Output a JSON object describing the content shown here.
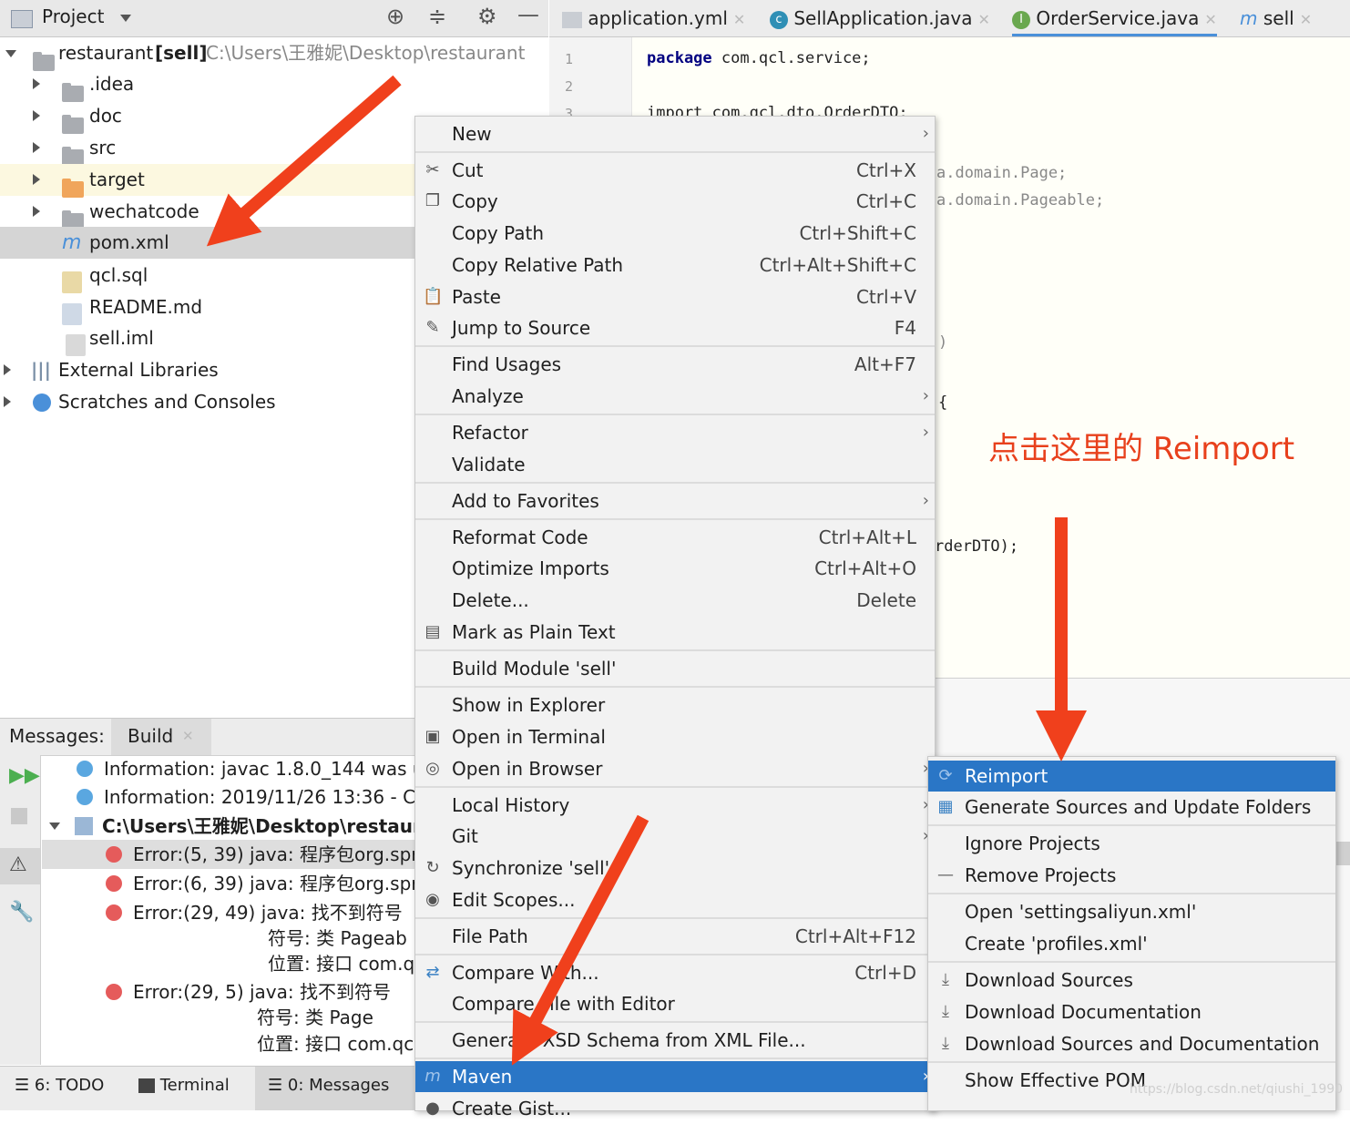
{
  "project_panel": {
    "title": "Project",
    "tree": [
      {
        "label": "restaurant",
        "module": "[sell]",
        "path": "C:\\Users\\王雅妮\\Desktop\\restaurant"
      },
      {
        "label": ".idea"
      },
      {
        "label": "doc"
      },
      {
        "label": "src"
      },
      {
        "label": "target"
      },
      {
        "label": "wechatcode"
      },
      {
        "label": "pom.xml"
      },
      {
        "label": "qcl.sql"
      },
      {
        "label": "README.md"
      },
      {
        "label": "sell.iml"
      },
      {
        "label": "External Libraries"
      },
      {
        "label": "Scratches and Consoles"
      }
    ]
  },
  "tabs": [
    {
      "label": "application.yml"
    },
    {
      "label": "SellApplication.java"
    },
    {
      "label": "OrderService.java"
    },
    {
      "label": "sell"
    }
  ],
  "editor": {
    "line_numbers": [
      "1",
      "2",
      "3"
    ],
    "lines": {
      "l1_kw": "package",
      "l1_rest": " com.qcl.service;",
      "l3": "import com.qcl.dto.OrderDTO;",
      "frag1": "a.domain.Page;",
      "frag2": "a.domain.Pageable;",
      "frag3": ")",
      "frag4": "{",
      "frag5": "rderDTO);"
    }
  },
  "messages_panel": {
    "tab_label": "Messages:",
    "build_tab": "Build",
    "rows": [
      {
        "text": "Information: javac 1.8.0_144 was use"
      },
      {
        "text": "Information: 2019/11/26 13:36 - Co"
      },
      {
        "text": "C:\\Users\\王雅妮\\Desktop\\restauran"
      },
      {
        "text": "Error:(5, 39)  java: 程序包org.spri"
      },
      {
        "text": "Error:(6, 39)  java: 程序包org.spri"
      },
      {
        "text": "Error:(29, 49)  java: 找不到符号"
      },
      {
        "text": "符号:   类 Pageab"
      },
      {
        "text": "位置: 接口 com.q"
      },
      {
        "text": "Error:(29, 5)  java: 找不到符号"
      },
      {
        "text": "符号:   类 Page"
      },
      {
        "text": "位置: 接口 com.qcl"
      }
    ]
  },
  "bottom_tools": {
    "todo": "6: TODO",
    "terminal": "Terminal",
    "messages": "0: Messages"
  },
  "context_menu": {
    "items": [
      {
        "label": "New",
        "shortcut": ""
      },
      {
        "label": "Cut",
        "shortcut": "Ctrl+X"
      },
      {
        "label": "Copy",
        "shortcut": "Ctrl+C"
      },
      {
        "label": "Copy Path",
        "shortcut": "Ctrl+Shift+C"
      },
      {
        "label": "Copy Relative Path",
        "shortcut": "Ctrl+Alt+Shift+C"
      },
      {
        "label": "Paste",
        "shortcut": "Ctrl+V"
      },
      {
        "label": "Jump to Source",
        "shortcut": "F4"
      },
      {
        "label": "Find Usages",
        "shortcut": "Alt+F7"
      },
      {
        "label": "Analyze",
        "shortcut": ""
      },
      {
        "label": "Refactor",
        "shortcut": ""
      },
      {
        "label": "Validate",
        "shortcut": ""
      },
      {
        "label": "Add to Favorites",
        "shortcut": ""
      },
      {
        "label": "Reformat Code",
        "shortcut": "Ctrl+Alt+L"
      },
      {
        "label": "Optimize Imports",
        "shortcut": "Ctrl+Alt+O"
      },
      {
        "label": "Delete...",
        "shortcut": "Delete"
      },
      {
        "label": "Mark as Plain Text",
        "shortcut": ""
      },
      {
        "label": "Build Module 'sell'",
        "shortcut": ""
      },
      {
        "label": "Show in Explorer",
        "shortcut": ""
      },
      {
        "label": "Open in Terminal",
        "shortcut": ""
      },
      {
        "label": "Open in Browser",
        "shortcut": ""
      },
      {
        "label": "Local History",
        "shortcut": ""
      },
      {
        "label": "Git",
        "shortcut": ""
      },
      {
        "label": "Synchronize 'sell'",
        "shortcut": ""
      },
      {
        "label": "Edit Scopes...",
        "shortcut": ""
      },
      {
        "label": "File Path",
        "shortcut": "Ctrl+Alt+F12"
      },
      {
        "label": "Compare With...",
        "shortcut": "Ctrl+D"
      },
      {
        "label": "Compare File with Editor",
        "shortcut": ""
      },
      {
        "label": "Generate XSD Schema from XML File...",
        "shortcut": ""
      },
      {
        "label": "Maven",
        "shortcut": ""
      },
      {
        "label": "Create Gist...",
        "shortcut": ""
      }
    ]
  },
  "maven_submenu": {
    "items": [
      {
        "label": "Reimport"
      },
      {
        "label": "Generate Sources and Update Folders"
      },
      {
        "label": "Ignore Projects"
      },
      {
        "label": "Remove Projects"
      },
      {
        "label": "Open 'settingsaliyun.xml'"
      },
      {
        "label": "Create 'profiles.xml'"
      },
      {
        "label": "Download Sources"
      },
      {
        "label": "Download Documentation"
      },
      {
        "label": "Download Sources and Documentation"
      },
      {
        "label": "Show Effective POM"
      }
    ]
  },
  "annotation": "点击这里的 Reimport",
  "watermark": "https://blog.csdn.net/qiushi_1990",
  "colors": {
    "selection": "#2a76c6",
    "annotation_red": "#e8401c",
    "error": "#e55b5b",
    "info": "#5aa7e0"
  }
}
